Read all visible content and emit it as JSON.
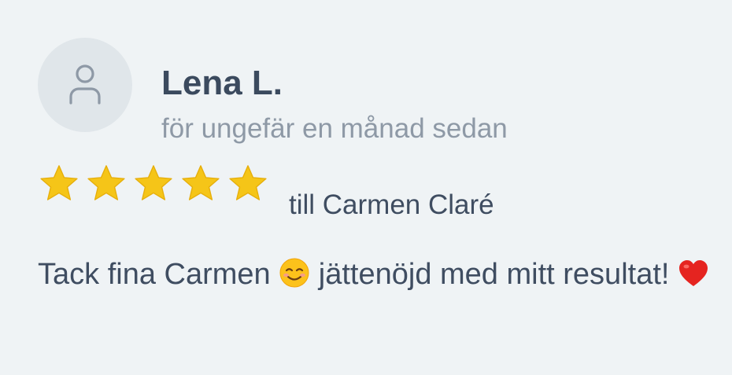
{
  "review": {
    "author": {
      "name": "Lena L.",
      "avatar_icon": "user-icon"
    },
    "time_ago": "för ungefär en månad sedan",
    "rating": 5,
    "rating_max": 5,
    "star_color": "#f5c518",
    "recipient": "till Carmen Claré",
    "text_part1": "Tack fina Carmen",
    "emoji_1": "smiling-face-icon",
    "text_part2": "jättenöjd med mitt resultat!",
    "emoji_2": "red-heart-icon"
  }
}
